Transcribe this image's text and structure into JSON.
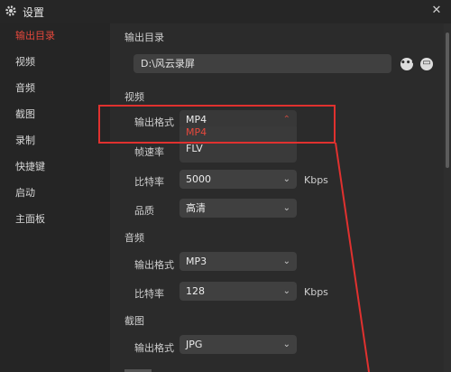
{
  "window": {
    "title": "设置",
    "close_glyph": "✕"
  },
  "sidebar": {
    "items": [
      {
        "label": "输出目录",
        "active": true
      },
      {
        "label": "视频"
      },
      {
        "label": "音频"
      },
      {
        "label": "截图"
      },
      {
        "label": "录制"
      },
      {
        "label": "快捷键"
      },
      {
        "label": "启动"
      },
      {
        "label": "主面板"
      }
    ]
  },
  "output_dir": {
    "section": "输出目录",
    "path": "D:\\风云录屏",
    "more_button": "•••",
    "folder_button": "▭"
  },
  "video": {
    "section": "视频",
    "format_label": "输出格式",
    "format_value": "MP4",
    "format_options": [
      "MP4",
      "FLV"
    ],
    "fps_label": "帧速率",
    "bitrate_label": "比特率",
    "bitrate_value": "5000",
    "bitrate_unit": "Kbps",
    "quality_label": "品质",
    "quality_value": "高清"
  },
  "audio": {
    "section": "音频",
    "format_label": "输出格式",
    "format_value": "MP3",
    "bitrate_label": "比特率",
    "bitrate_value": "128",
    "bitrate_unit": "Kbps"
  },
  "screenshot": {
    "section": "截图",
    "format_label": "输出格式",
    "format_value": "JPG"
  },
  "colors": {
    "accent": "#e5483c",
    "annotation": "#e0312f"
  },
  "chevron_glyph": "⌄"
}
